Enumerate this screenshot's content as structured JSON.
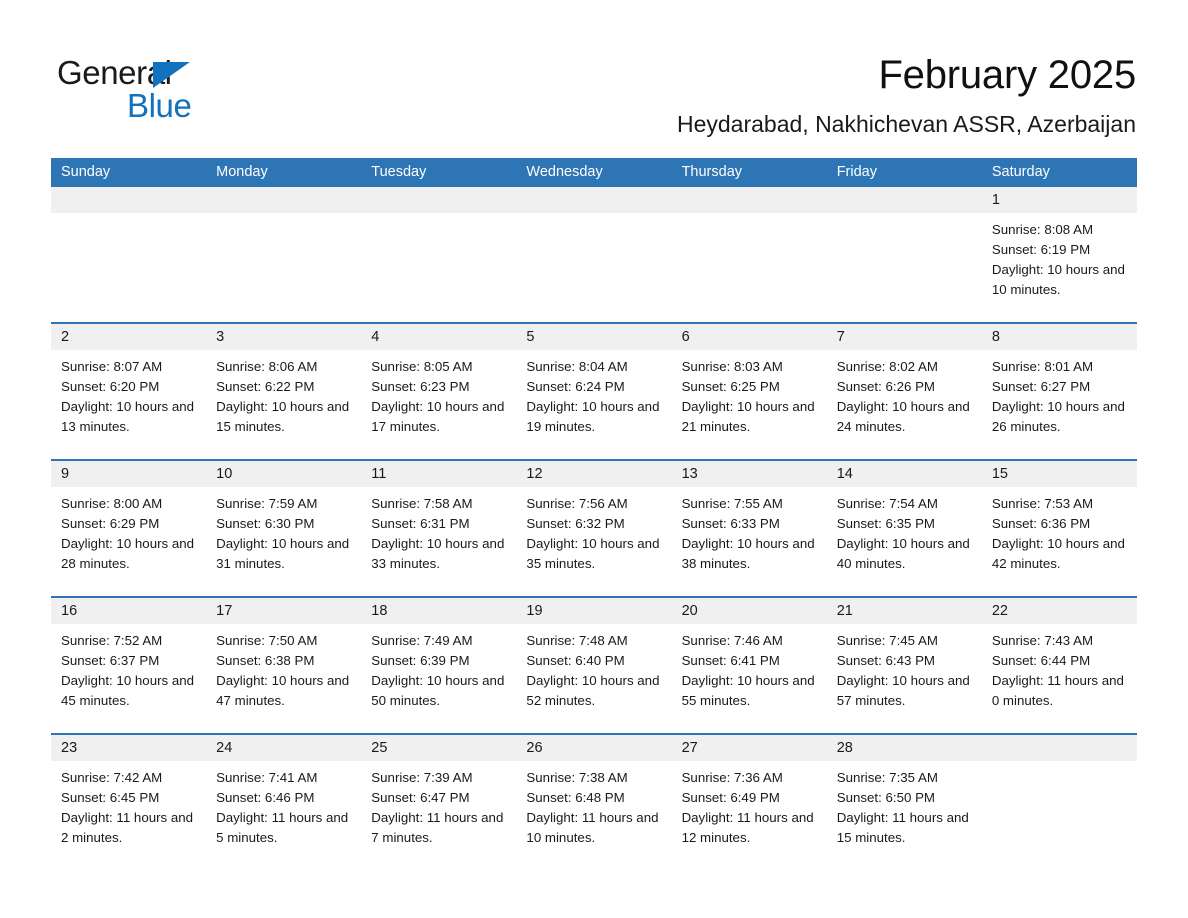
{
  "brand": {
    "name_part1": "General",
    "name_part2": "Blue",
    "accent_color": "#1272bd"
  },
  "header": {
    "month_title": "February 2025",
    "location": "Heydarabad, Nakhichevan ASSR, Azerbaijan"
  },
  "theme": {
    "header_blue": "#2e75b6",
    "daynum_band": "#f0f0f0",
    "page_background": "#ffffff"
  },
  "weekdays": [
    "Sunday",
    "Monday",
    "Tuesday",
    "Wednesday",
    "Thursday",
    "Friday",
    "Saturday"
  ],
  "weeks": [
    [
      {
        "day": "",
        "empty": true
      },
      {
        "day": "",
        "empty": true
      },
      {
        "day": "",
        "empty": true
      },
      {
        "day": "",
        "empty": true
      },
      {
        "day": "",
        "empty": true
      },
      {
        "day": "",
        "empty": true
      },
      {
        "day": "1",
        "sunrise": "Sunrise: 8:08 AM",
        "sunset": "Sunset: 6:19 PM",
        "daylight": "Daylight: 10 hours and 10 minutes."
      }
    ],
    [
      {
        "day": "2",
        "sunrise": "Sunrise: 8:07 AM",
        "sunset": "Sunset: 6:20 PM",
        "daylight": "Daylight: 10 hours and 13 minutes."
      },
      {
        "day": "3",
        "sunrise": "Sunrise: 8:06 AM",
        "sunset": "Sunset: 6:22 PM",
        "daylight": "Daylight: 10 hours and 15 minutes."
      },
      {
        "day": "4",
        "sunrise": "Sunrise: 8:05 AM",
        "sunset": "Sunset: 6:23 PM",
        "daylight": "Daylight: 10 hours and 17 minutes."
      },
      {
        "day": "5",
        "sunrise": "Sunrise: 8:04 AM",
        "sunset": "Sunset: 6:24 PM",
        "daylight": "Daylight: 10 hours and 19 minutes."
      },
      {
        "day": "6",
        "sunrise": "Sunrise: 8:03 AM",
        "sunset": "Sunset: 6:25 PM",
        "daylight": "Daylight: 10 hours and 21 minutes."
      },
      {
        "day": "7",
        "sunrise": "Sunrise: 8:02 AM",
        "sunset": "Sunset: 6:26 PM",
        "daylight": "Daylight: 10 hours and 24 minutes."
      },
      {
        "day": "8",
        "sunrise": "Sunrise: 8:01 AM",
        "sunset": "Sunset: 6:27 PM",
        "daylight": "Daylight: 10 hours and 26 minutes."
      }
    ],
    [
      {
        "day": "9",
        "sunrise": "Sunrise: 8:00 AM",
        "sunset": "Sunset: 6:29 PM",
        "daylight": "Daylight: 10 hours and 28 minutes."
      },
      {
        "day": "10",
        "sunrise": "Sunrise: 7:59 AM",
        "sunset": "Sunset: 6:30 PM",
        "daylight": "Daylight: 10 hours and 31 minutes."
      },
      {
        "day": "11",
        "sunrise": "Sunrise: 7:58 AM",
        "sunset": "Sunset: 6:31 PM",
        "daylight": "Daylight: 10 hours and 33 minutes."
      },
      {
        "day": "12",
        "sunrise": "Sunrise: 7:56 AM",
        "sunset": "Sunset: 6:32 PM",
        "daylight": "Daylight: 10 hours and 35 minutes."
      },
      {
        "day": "13",
        "sunrise": "Sunrise: 7:55 AM",
        "sunset": "Sunset: 6:33 PM",
        "daylight": "Daylight: 10 hours and 38 minutes."
      },
      {
        "day": "14",
        "sunrise": "Sunrise: 7:54 AM",
        "sunset": "Sunset: 6:35 PM",
        "daylight": "Daylight: 10 hours and 40 minutes."
      },
      {
        "day": "15",
        "sunrise": "Sunrise: 7:53 AM",
        "sunset": "Sunset: 6:36 PM",
        "daylight": "Daylight: 10 hours and 42 minutes."
      }
    ],
    [
      {
        "day": "16",
        "sunrise": "Sunrise: 7:52 AM",
        "sunset": "Sunset: 6:37 PM",
        "daylight": "Daylight: 10 hours and 45 minutes."
      },
      {
        "day": "17",
        "sunrise": "Sunrise: 7:50 AM",
        "sunset": "Sunset: 6:38 PM",
        "daylight": "Daylight: 10 hours and 47 minutes."
      },
      {
        "day": "18",
        "sunrise": "Sunrise: 7:49 AM",
        "sunset": "Sunset: 6:39 PM",
        "daylight": "Daylight: 10 hours and 50 minutes."
      },
      {
        "day": "19",
        "sunrise": "Sunrise: 7:48 AM",
        "sunset": "Sunset: 6:40 PM",
        "daylight": "Daylight: 10 hours and 52 minutes."
      },
      {
        "day": "20",
        "sunrise": "Sunrise: 7:46 AM",
        "sunset": "Sunset: 6:41 PM",
        "daylight": "Daylight: 10 hours and 55 minutes."
      },
      {
        "day": "21",
        "sunrise": "Sunrise: 7:45 AM",
        "sunset": "Sunset: 6:43 PM",
        "daylight": "Daylight: 10 hours and 57 minutes."
      },
      {
        "day": "22",
        "sunrise": "Sunrise: 7:43 AM",
        "sunset": "Sunset: 6:44 PM",
        "daylight": "Daylight: 11 hours and 0 minutes."
      }
    ],
    [
      {
        "day": "23",
        "sunrise": "Sunrise: 7:42 AM",
        "sunset": "Sunset: 6:45 PM",
        "daylight": "Daylight: 11 hours and 2 minutes."
      },
      {
        "day": "24",
        "sunrise": "Sunrise: 7:41 AM",
        "sunset": "Sunset: 6:46 PM",
        "daylight": "Daylight: 11 hours and 5 minutes."
      },
      {
        "day": "25",
        "sunrise": "Sunrise: 7:39 AM",
        "sunset": "Sunset: 6:47 PM",
        "daylight": "Daylight: 11 hours and 7 minutes."
      },
      {
        "day": "26",
        "sunrise": "Sunrise: 7:38 AM",
        "sunset": "Sunset: 6:48 PM",
        "daylight": "Daylight: 11 hours and 10 minutes."
      },
      {
        "day": "27",
        "sunrise": "Sunrise: 7:36 AM",
        "sunset": "Sunset: 6:49 PM",
        "daylight": "Daylight: 11 hours and 12 minutes."
      },
      {
        "day": "28",
        "sunrise": "Sunrise: 7:35 AM",
        "sunset": "Sunset: 6:50 PM",
        "daylight": "Daylight: 11 hours and 15 minutes."
      },
      {
        "day": "",
        "empty": true
      }
    ]
  ]
}
